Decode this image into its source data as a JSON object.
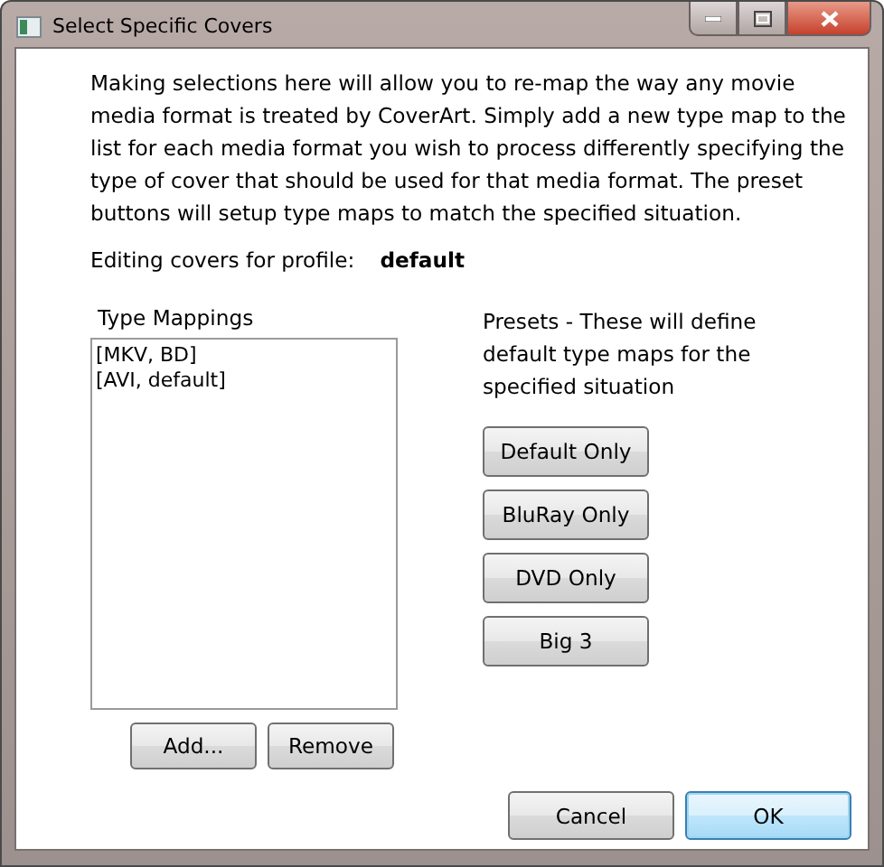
{
  "window": {
    "title": "Select Specific Covers"
  },
  "description": "Making selections here will allow you to re-map the way any movie media format is treated by CoverArt.  Simply add a new type map to the list for each media format you wish to process differently specifying the type of cover that should be used for that media format.  The preset buttons will setup type maps to match the specified situation.",
  "profile": {
    "label": "Editing covers for profile:",
    "value": "default"
  },
  "type_mappings": {
    "label": "Type Mappings",
    "items": [
      "[MKV, BD]",
      "[AVI, default]"
    ],
    "buttons": [
      "Add...",
      "Remove"
    ]
  },
  "presets": {
    "description": "Presets - These will define default type maps for the specified situation",
    "buttons": [
      "Default Only",
      "BluRay Only",
      "DVD Only",
      "Big 3"
    ]
  },
  "dialog_buttons": [
    {
      "label": "Cancel",
      "default": false
    },
    {
      "label": "OK",
      "default": true
    }
  ]
}
